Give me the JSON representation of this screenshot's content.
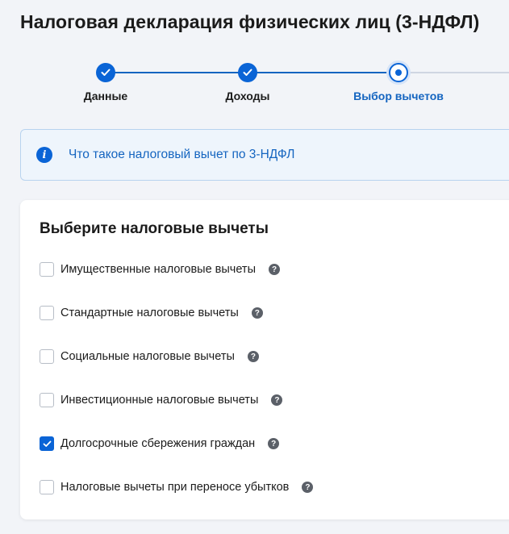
{
  "page": {
    "title": "Налоговая декларация физических лиц (3-НДФЛ)"
  },
  "stepper": {
    "steps": [
      {
        "label": "Данные",
        "state": "done"
      },
      {
        "label": "Доходы",
        "state": "done"
      },
      {
        "label": "Выбор вычетов",
        "state": "current"
      }
    ]
  },
  "info": {
    "link_text": "Что такое налоговый вычет по 3-НДФЛ",
    "icon": "info-icon"
  },
  "deductions": {
    "title": "Выберите налоговые вычеты",
    "options": [
      {
        "label": "Имущественные налоговые вычеты",
        "checked": false
      },
      {
        "label": "Стандартные налоговые вычеты",
        "checked": false
      },
      {
        "label": "Социальные налоговые вычеты",
        "checked": false
      },
      {
        "label": "Инвестиционные налоговые вычеты",
        "checked": false
      },
      {
        "label": "Долгосрочные сбережения граждан",
        "checked": true
      },
      {
        "label": "Налоговые вычеты при переносе убытков",
        "checked": false
      }
    ],
    "help_symbol": "?"
  },
  "colors": {
    "accent": "#0a64d6",
    "link": "#1565c0",
    "info_bg": "#eef5fc",
    "help_icon": "#5b6068"
  }
}
